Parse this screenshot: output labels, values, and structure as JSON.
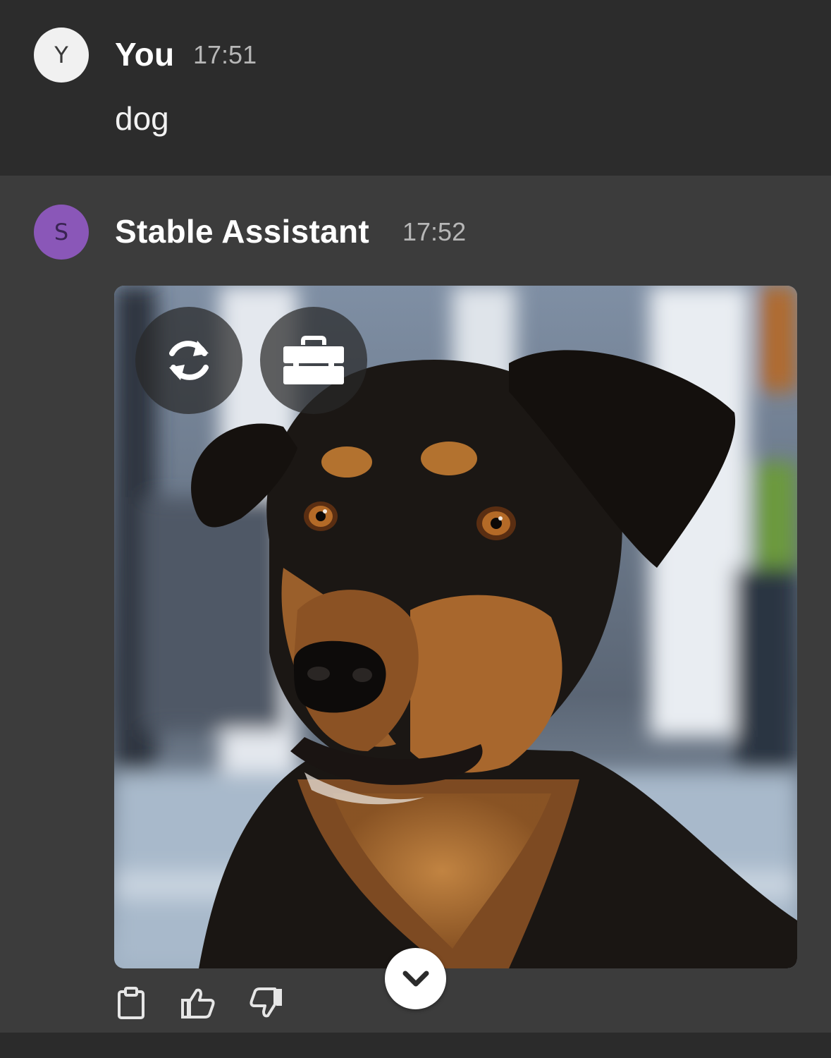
{
  "conversation": {
    "user_message": {
      "avatar_letter": "Y",
      "author": "You",
      "time": "17:51",
      "text": "dog"
    },
    "assistant_message": {
      "avatar_letter": "S",
      "author": "Stable Assistant",
      "time": "17:52",
      "image": {
        "subject": "generated-dog-photo",
        "overlay_buttons": [
          "regenerate-icon",
          "toolbox-icon"
        ]
      },
      "actions": [
        "clipboard-icon",
        "thumbs-up-icon",
        "thumbs-down-icon"
      ]
    },
    "scroll_button_icon": "chevron-down-icon"
  },
  "colors": {
    "user_bg": "#2c2c2c",
    "assistant_bg": "#3c3c3c",
    "user_avatar": "#f1f1f1",
    "assistant_avatar": "#8a57b8",
    "timestamp": "#b7b7b7"
  }
}
